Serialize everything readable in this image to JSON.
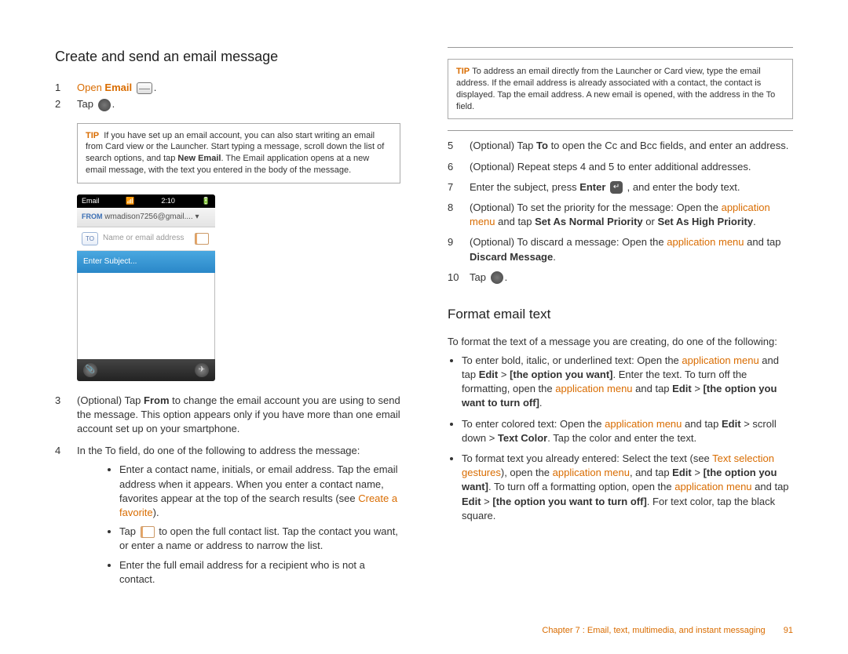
{
  "headings": {
    "h_create": "Create and send an email message",
    "h_format": "Format email text"
  },
  "left": {
    "step1_pre": "Open ",
    "step1_bold": "Email",
    "step1_post": " ",
    "step2": "Tap ",
    "tip_label": "TIP",
    "tip1": "If you have set up an email account, you can also start writing an email from Card view or the Launcher. Start typing a message, scroll down the list of search options, and tap ",
    "tip1_bold": "New Email",
    "tip1_after": ". The Email application opens at a new email message, with the text you entered in the body of the message.",
    "phone": {
      "status_left": "Email",
      "status_center": "2:10",
      "from_label": "FROM",
      "from_value": "wmadison7256@gmail....",
      "to_label": "TO",
      "to_placeholder": "Name or email address",
      "subject_placeholder": "Enter Subject..."
    },
    "step3_a": "(Optional) Tap ",
    "step3_b": "From",
    "step3_c": " to change the email account you are using to send the message. This option appears only if you have more than one email account set up on your smartphone.",
    "step4": "In the To field, do one of the following to address the message:",
    "b1_a": "Enter a contact name, initials, or email address. Tap the email address when it appears. When you enter a contact name, favorites appear at the top of the search results (see ",
    "b1_link": "Create a favorite",
    "b1_c": ").",
    "b2_a": "Tap ",
    "b2_b": " to open the full contact list. Tap the contact you want, or enter a name or address to narrow the list.",
    "b3": "Enter the full email address for a recipient who is not a contact."
  },
  "right": {
    "tip_label": "TIP",
    "tip2": "To address an email directly from the Launcher or Card view, type the email address. If the email address is already associated with a contact, the contact is displayed. Tap the email address. A new email is opened, with the address in the To field.",
    "s5_a": "(Optional) Tap ",
    "s5_b": "To",
    "s5_c": " to open the Cc and Bcc fields, and enter an address.",
    "s6": "(Optional) Repeat steps 4 and 5 to enter additional addresses.",
    "s7_a": "Enter the subject, press ",
    "s7_b": "Enter",
    "s7_c": " , and enter the body text.",
    "s8_a": "(Optional) To set the priority for the message: Open the ",
    "s8_link": "application menu",
    "s8_b": " and tap ",
    "s8_bold1": "Set As Normal Priority",
    "s8_or": " or ",
    "s8_bold2": "Set As High Priority",
    "s8_dot": ".",
    "s9_a": "(Optional) To discard a message: Open the ",
    "s9_link": "application menu",
    "s9_b": " and tap ",
    "s9_bold": "Discard Message",
    "s9_dot": ".",
    "s10": "Tap ",
    "fmt_intro": "To format the text of a message you are creating, do one of the following:",
    "f1_a": "To enter bold, italic, or underlined text: Open the ",
    "f1_b": " and tap ",
    "f1_bold1": "Edit",
    "f1_gt": " > ",
    "f1_bold2": "[the option you want]",
    "f1_c": ". Enter the text. To turn off the formatting, open the ",
    "f1_d": " and tap ",
    "f1_bold3": "Edit",
    "f1_bold4": "[the option you want to turn off]",
    "f1_dot": ".",
    "f2_a": "To enter colored text: Open the ",
    "f2_b": " and tap ",
    "f2_bold1": "Edit",
    "f2_c": " > scroll down > ",
    "f2_bold2": "Text Color",
    "f2_d": ". Tap the color and enter the text.",
    "f3_a": "To format text you already entered: Select the text (see ",
    "f3_link1": "Text selection gestures",
    "f3_b": "), open the ",
    "f3_c": ", and tap ",
    "f3_bold1": "Edit",
    "f3_bold2": "[the option you want]",
    "f3_d": ". To turn off a formatting option, open the ",
    "f3_e": " and tap ",
    "f3_bold3": "Edit",
    "f3_bold4": "[the option you want to turn off]",
    "f3_f": ". For text color, tap the black square.",
    "appmenu": "application menu"
  },
  "footer": {
    "chapter": "Chapter 7 : Email, text, multimedia, and instant messaging",
    "page": "91"
  }
}
